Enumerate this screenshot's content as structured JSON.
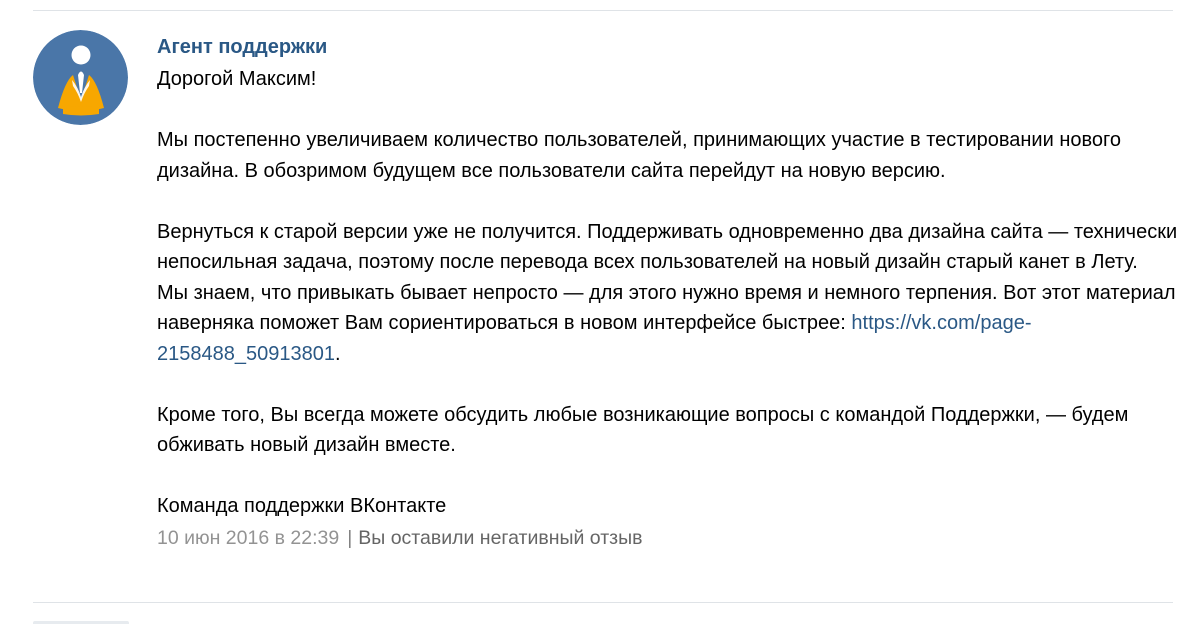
{
  "message": {
    "author": "Агент поддержки",
    "greeting": "Дорогой Максим!",
    "paragraph1": "Мы постепенно увеличиваем количество пользователей, принимающих участие в тестировании нового дизайна. В обозримом будущем все пользователи сайта перейдут на новую версию.",
    "paragraph2_line1": "Вернуться к старой версии уже не получится. Поддерживать одновременно два дизайна сайта — технически непосильная задача, поэтому после перевода всех пользователей на новый дизайн старый канет в Лету.",
    "paragraph2_line2_before_link": "Мы знаем, что привыкать бывает непросто — для этого нужно время и немного терпения. Вот этот материал наверняка поможет Вам сориентироваться в новом интерфейсе быстрее: ",
    "link_text": "https://vk.com/page-2158488_50913801",
    "paragraph2_after_link": ".",
    "paragraph3": "Кроме того, Вы всегда можете обсудить любые возникающие вопросы с командой Поддержки, — будем обживать новый дизайн вместе.",
    "signature": "Команда поддержки ВКонтакте",
    "date": "10 июн 2016 в 22:39",
    "separator": "|",
    "review_status": "Вы оставили негативный отзыв"
  },
  "avatar": {
    "icon": "support-agent-meditating-icon",
    "background_color": "#4a76a8",
    "figure_color": "#f7a700",
    "head_color": "#ffffff"
  },
  "colors": {
    "link": "#2a5885",
    "meta": "#939393",
    "divider": "#dfe3e7"
  }
}
